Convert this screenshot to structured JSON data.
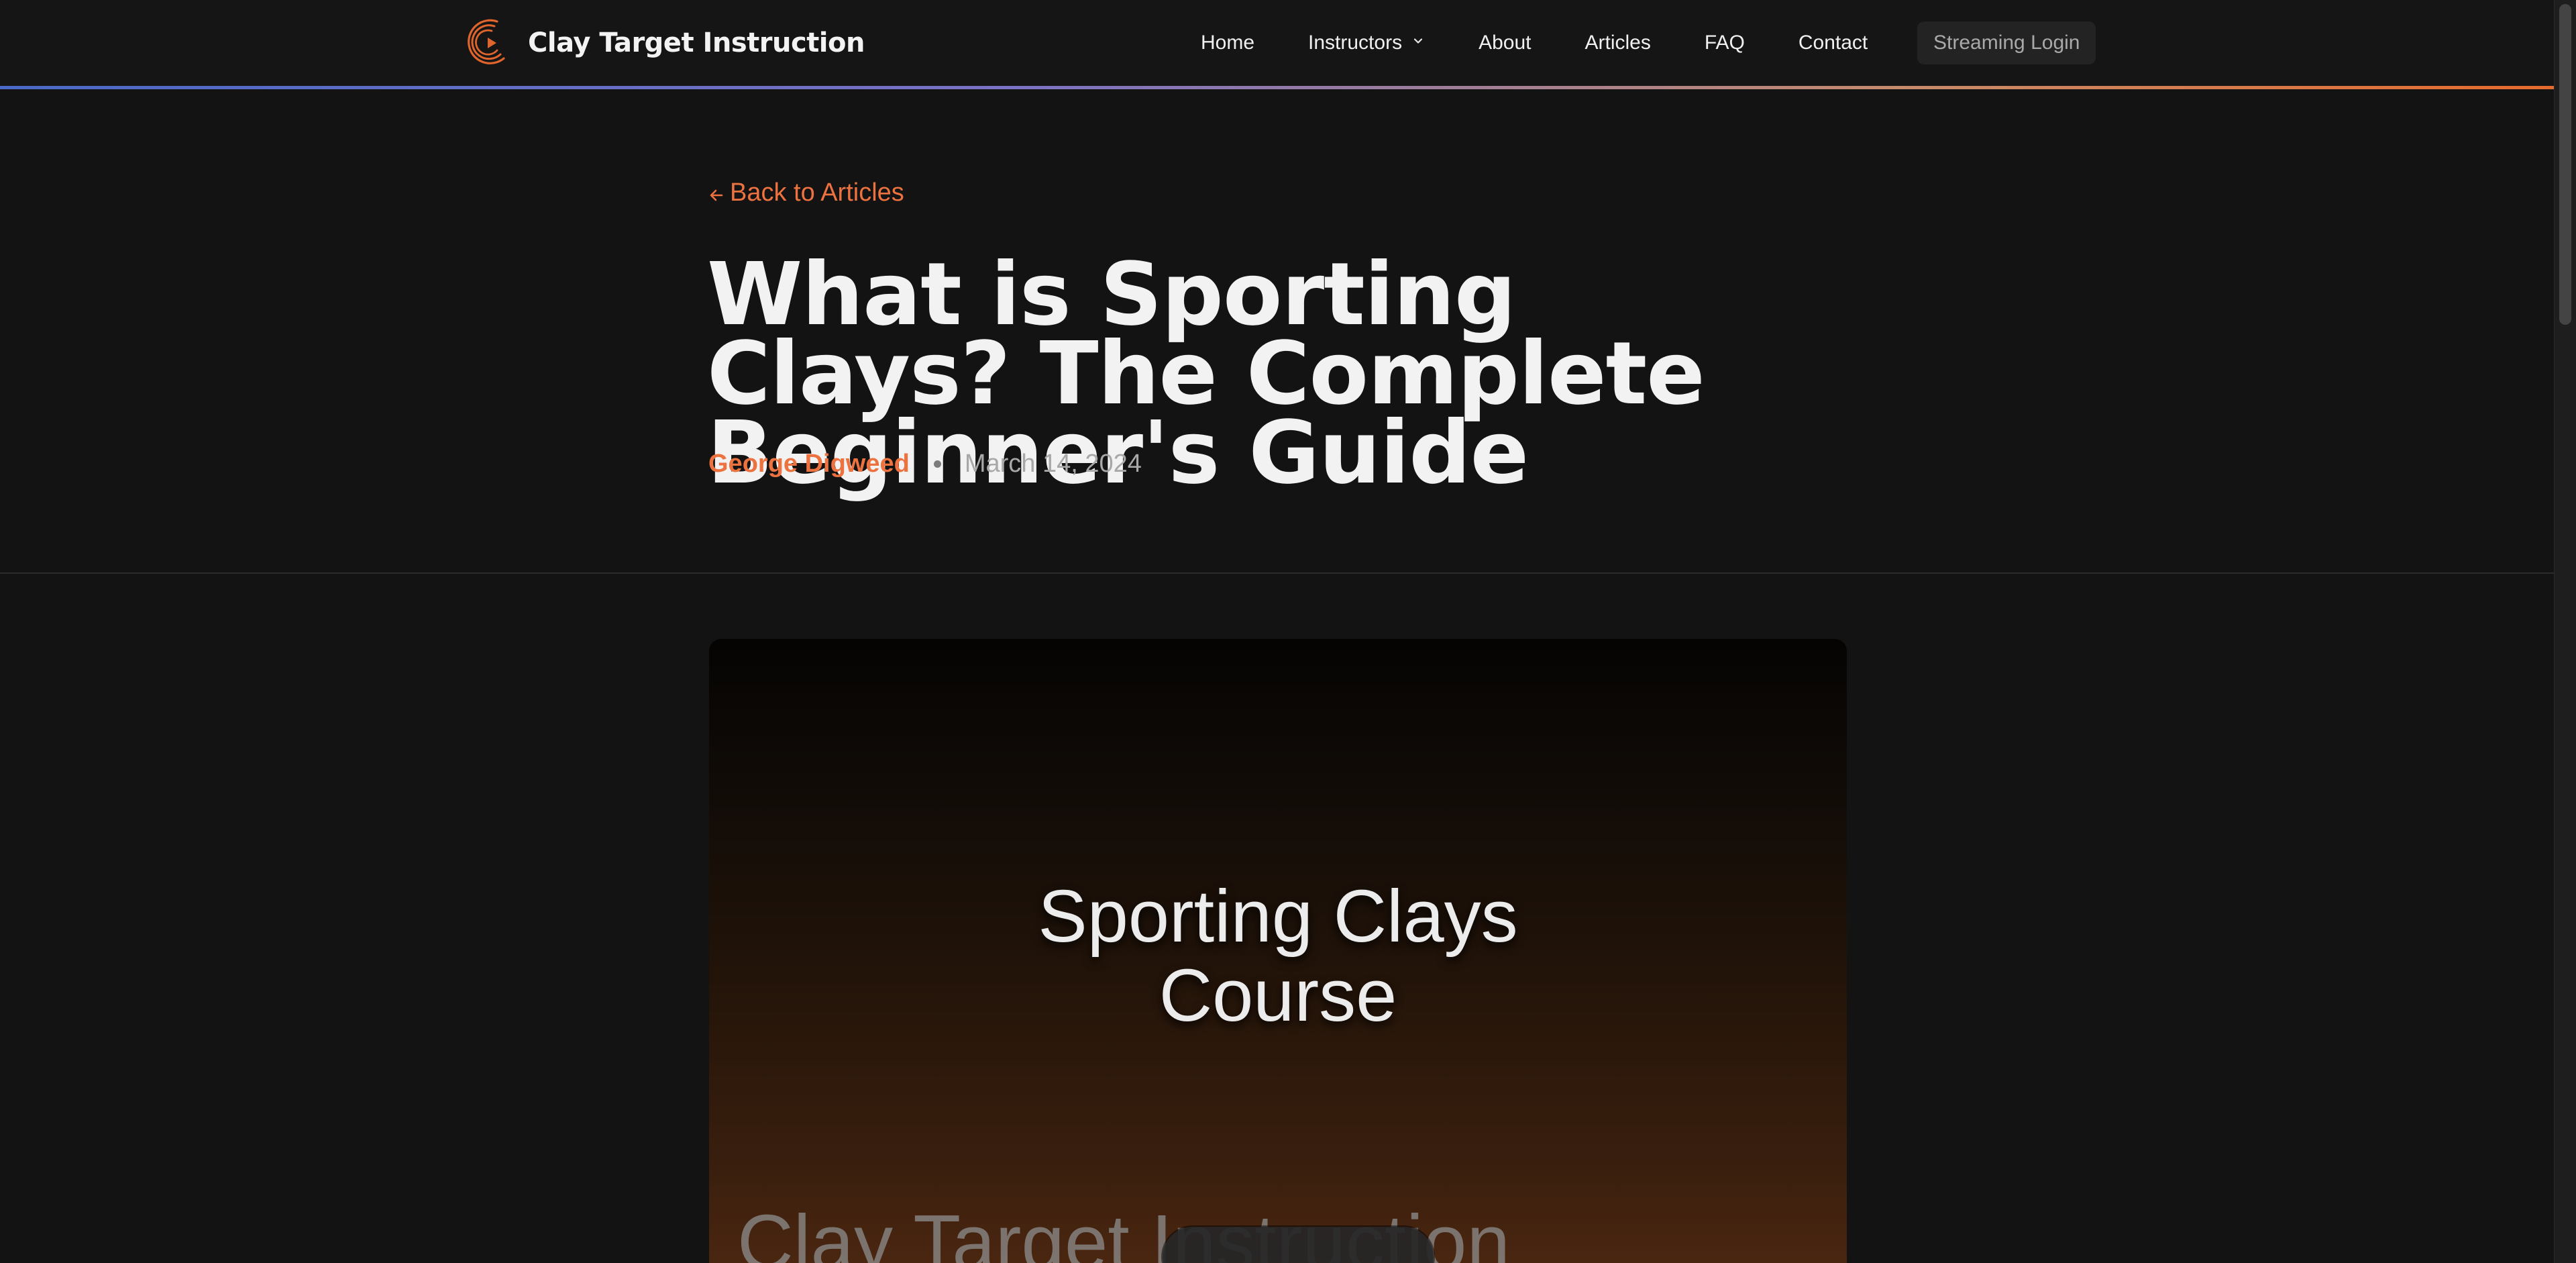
{
  "header": {
    "brand_name": "Clay Target Instruction",
    "logo_icon": "clay-target-play-logo",
    "accent_gradient": [
      "#4a69c6",
      "#7b72c4",
      "#e66a2c"
    ],
    "nav": [
      {
        "label": "Home"
      },
      {
        "label": "Instructors",
        "icon": "chevron-down-icon"
      },
      {
        "label": "About"
      },
      {
        "label": "Articles"
      },
      {
        "label": "FAQ"
      },
      {
        "label": "Contact"
      }
    ],
    "streaming_login_label": "Streaming Login"
  },
  "article": {
    "back_link_label": "Back to Articles",
    "back_icon": "arrow-left-icon",
    "title": "What is Sporting Clays? The Complete Beginner's Guide",
    "author": "George Digweed",
    "date": "March 14, 2024",
    "hero": {
      "caption": "Sporting Clays\nCourse",
      "watermark": "Clay Target Instruction"
    }
  },
  "colors": {
    "accent": "#ec7240",
    "background": "#131313",
    "header_background": "#151515"
  }
}
